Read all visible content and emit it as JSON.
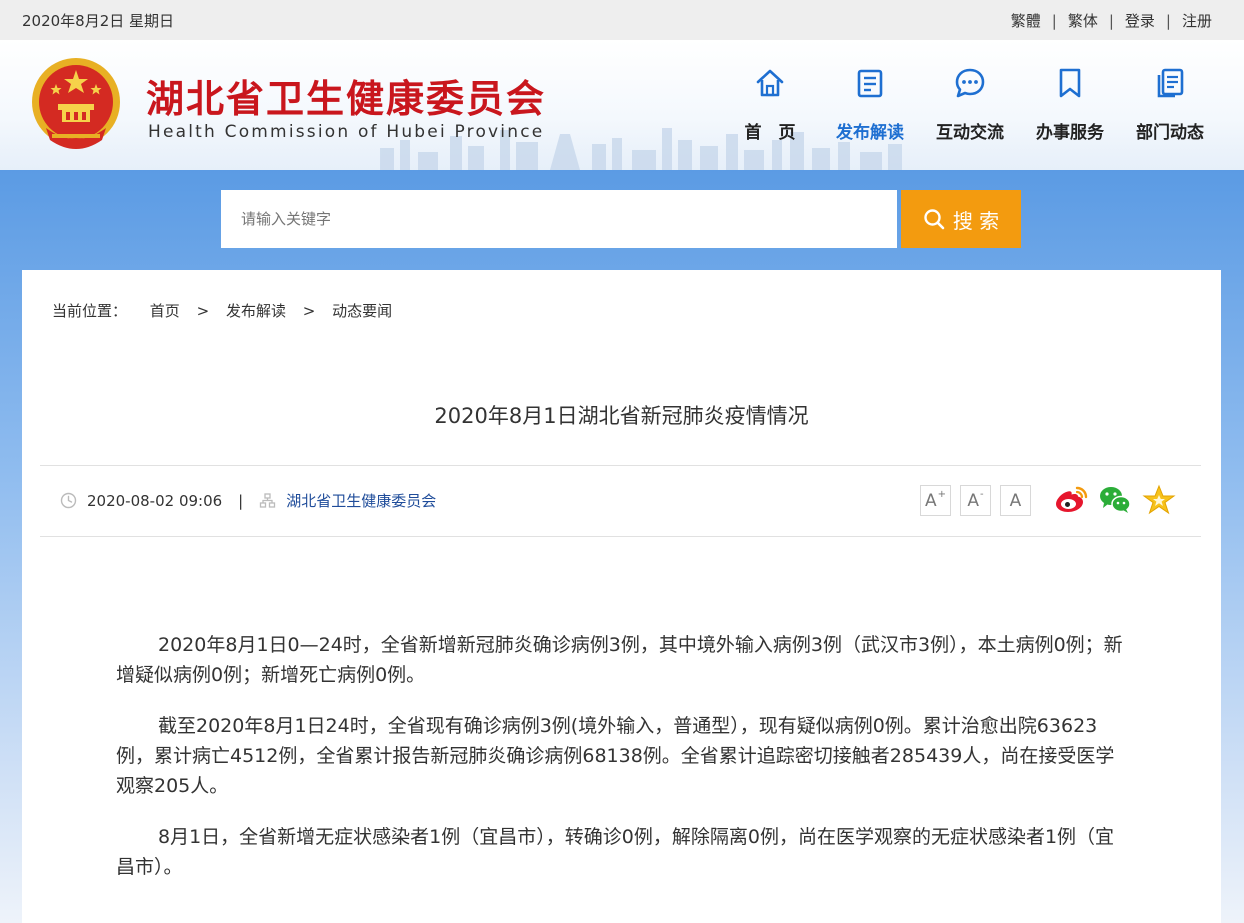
{
  "topbar": {
    "date": "2020年8月2日 星期日",
    "links": [
      "繁體",
      "繁体",
      "登录",
      "注册"
    ],
    "separator": "|"
  },
  "header": {
    "title": "湖北省卫生健康委员会",
    "subtitle": "Health Commission of Hubei Province",
    "accent_color": "#c9161d"
  },
  "nav": {
    "active_color": "#1e6fd1",
    "items": [
      {
        "label": "首　页",
        "icon": "home-icon"
      },
      {
        "label": "发布解读",
        "icon": "document-icon"
      },
      {
        "label": "互动交流",
        "icon": "chat-bubble-icon"
      },
      {
        "label": "办事服务",
        "icon": "bookmark-icon"
      },
      {
        "label": "部门动态",
        "icon": "pages-icon"
      }
    ]
  },
  "search": {
    "placeholder": "请输入关键字",
    "button_label": "搜 索",
    "button_color": "#f39b0f"
  },
  "breadcrumb": {
    "prefix": "当前位置：",
    "items": [
      "首页",
      "发布解读",
      "动态要闻"
    ],
    "arrow": ">"
  },
  "article": {
    "title": "2020年8月1日湖北省新冠肺炎疫情情况",
    "datetime": "2020-08-02 09:06",
    "meta_separator": "|",
    "source": "湖北省卫生健康委员会",
    "font_buttons": [
      {
        "label": "A",
        "sup": "+"
      },
      {
        "label": "A",
        "sup": "-"
      },
      {
        "label": "A",
        "sup": ""
      }
    ],
    "share_icons": [
      "weibo-icon",
      "wechat-icon",
      "favorite-star-icon"
    ],
    "paragraphs": [
      "2020年8月1日0—24时，全省新增新冠肺炎确诊病例3例，其中境外输入病例3例（武汉市3例），本土病例0例；新增疑似病例0例；新增死亡病例0例。",
      "截至2020年8月1日24时，全省现有确诊病例3例(境外输入，普通型），现有疑似病例0例。累计治愈出院63623例，累计病亡4512例，全省累计报告新冠肺炎确诊病例68138例。全省累计追踪密切接触者285439人，尚在接受医学观察205人。",
      "8月1日，全省新增无症状感染者1例（宜昌市），转确诊0例，解除隔离0例，尚在医学观察的无症状感染者1例（宜昌市）。"
    ]
  }
}
